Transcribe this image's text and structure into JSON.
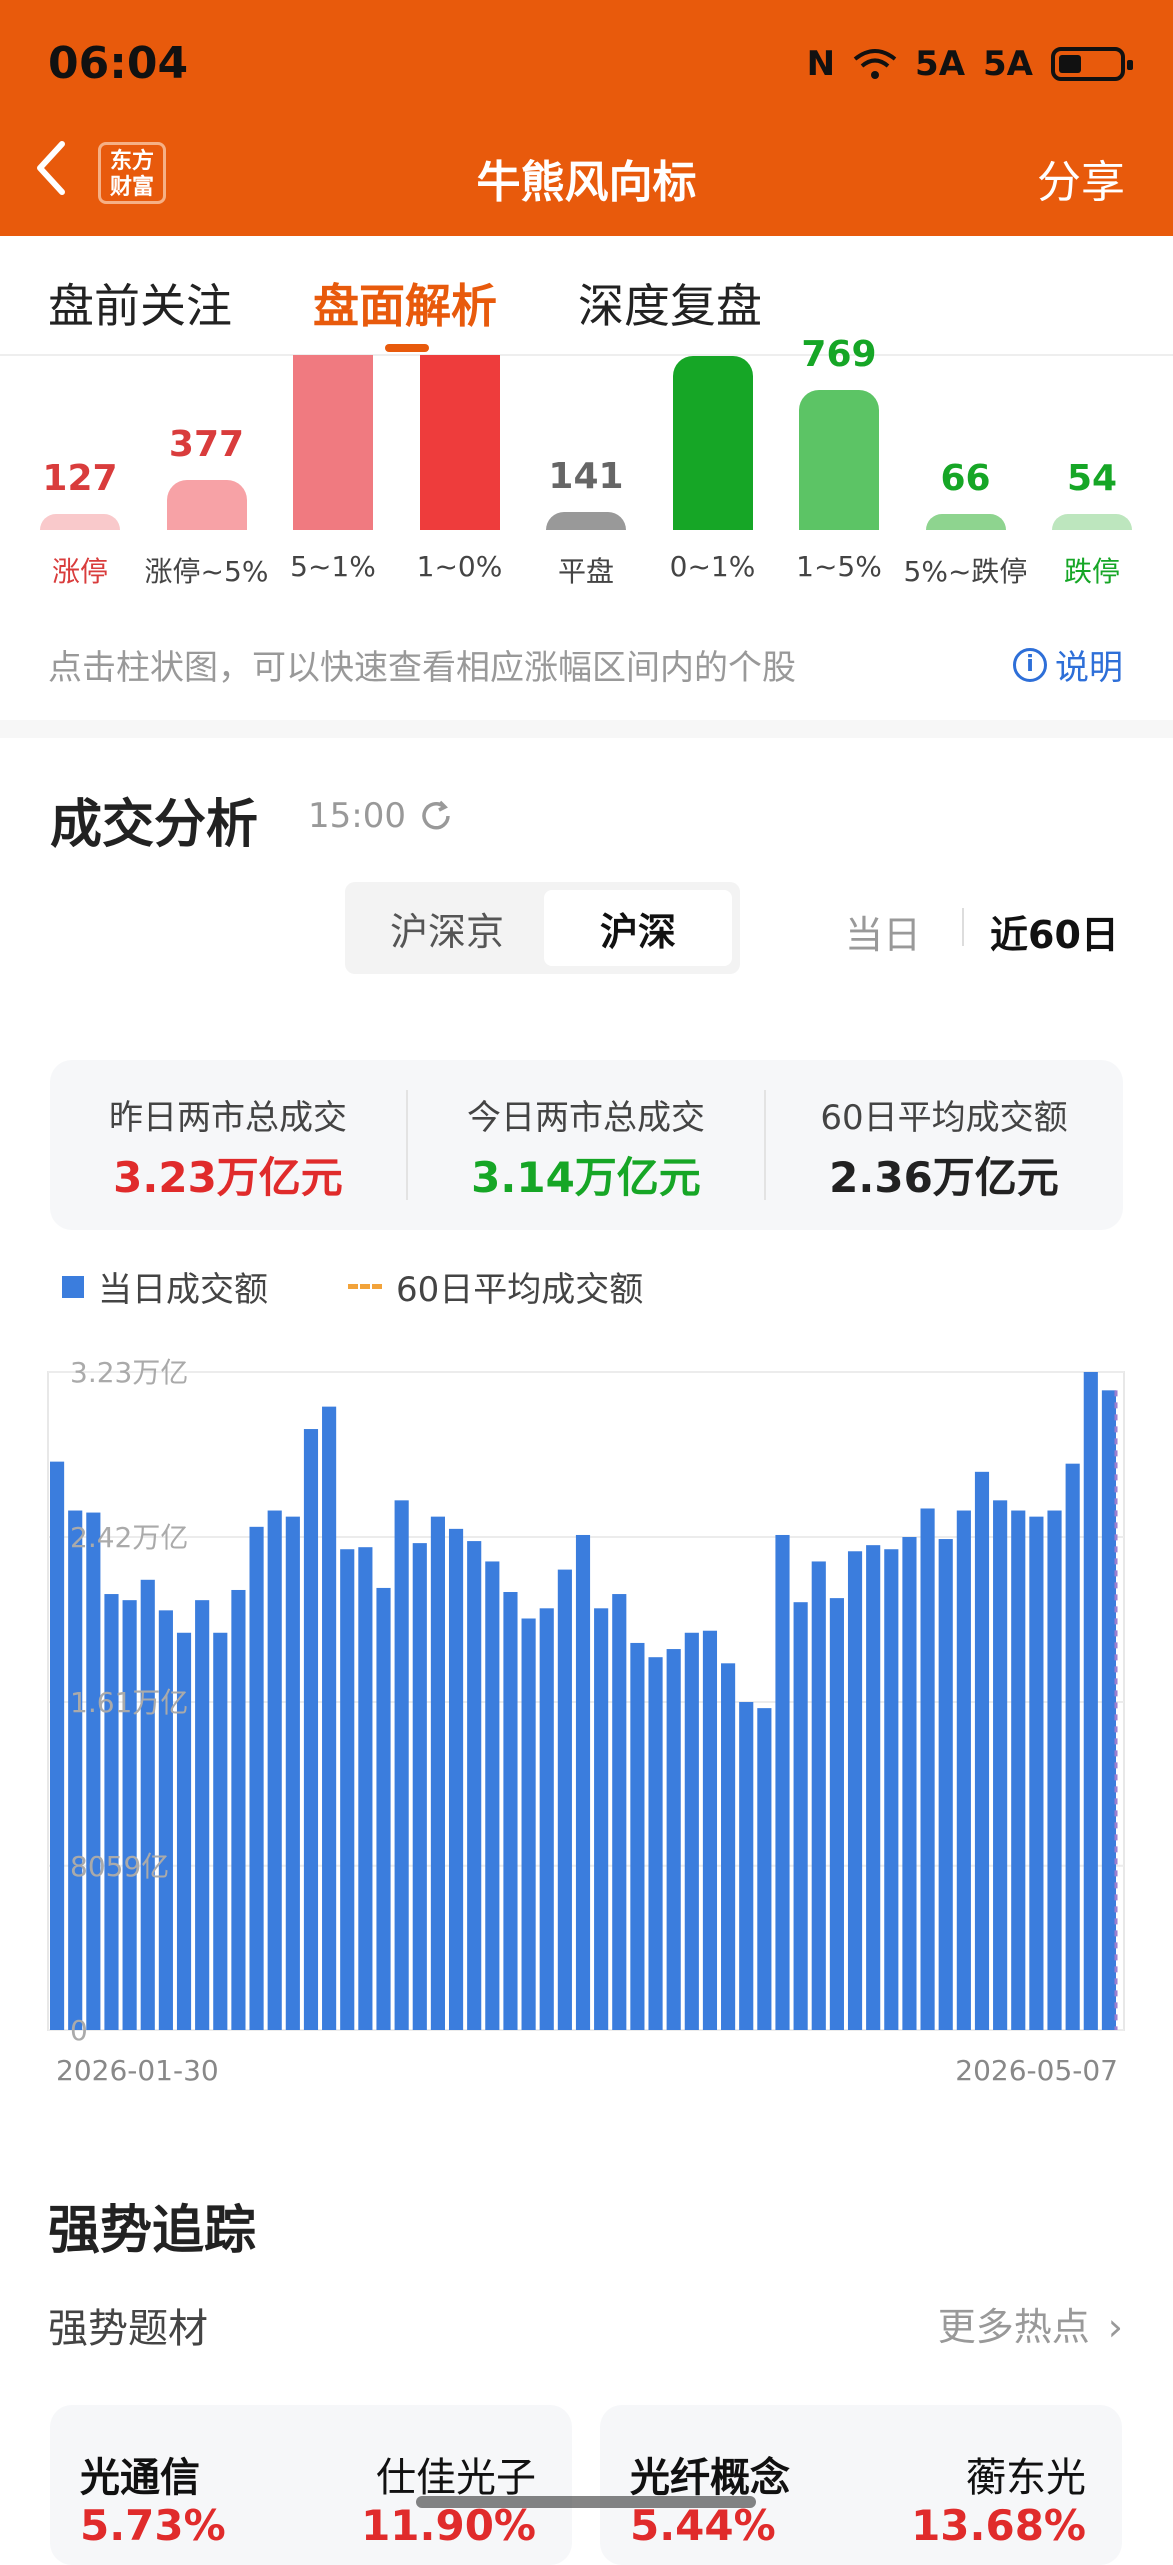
{
  "status_bar": {
    "time": "06:04",
    "signal1": "5A",
    "signal2": "5A"
  },
  "header": {
    "logo_text": "东方\n财富",
    "title": "牛熊风向标",
    "share": "分享"
  },
  "tabs": [
    {
      "label": "盘前关注",
      "active": false
    },
    {
      "label": "盘面解析",
      "active": true
    },
    {
      "label": "深度复盘",
      "active": false
    }
  ],
  "distribution": {
    "watermark": "东方财富",
    "bars": [
      {
        "category": "涨停",
        "count": "127",
        "color": "#F9C9CB",
        "label_color": "#D93C3C",
        "cat_color": "#D93C3C",
        "level": 0.08
      },
      {
        "category": "涨停~5%",
        "count": "377",
        "color": "#F7A2A6",
        "label_color": "#D93C3C",
        "cat_color": "#444444",
        "level": 0.25
      },
      {
        "category": "5~1%",
        "count": "",
        "color": "#F07A80",
        "label_color": "#D93C3C",
        "cat_color": "#444444",
        "level": 1.0
      },
      {
        "category": "1~0%",
        "count": "",
        "color": "#EE3C3C",
        "label_color": "#D93C3C",
        "cat_color": "#444444",
        "level": 0.98
      },
      {
        "category": "平盘",
        "count": "141",
        "color": "#999999",
        "label_color": "#666666",
        "cat_color": "#444444",
        "level": 0.09
      },
      {
        "category": "0~1%",
        "count": "",
        "color": "#16A626",
        "label_color": "#16A626",
        "cat_color": "#444444",
        "level": 0.87
      },
      {
        "category": "1~5%",
        "count": "769",
        "color": "#5CC465",
        "label_color": "#16A626",
        "cat_color": "#444444",
        "level": 0.7
      },
      {
        "category": "5%~跌停",
        "count": "66",
        "color": "#8ED48F",
        "label_color": "#16A626",
        "cat_color": "#444444",
        "level": 0.08
      },
      {
        "category": "跌停",
        "count": "54",
        "color": "#BDE6BE",
        "label_color": "#16A626",
        "cat_color": "#16A626",
        "level": 0.08
      }
    ],
    "hint": "点击柱状图，可以快速查看相应涨幅区间内的个股",
    "explain": "说明"
  },
  "volume": {
    "title": "成交分析",
    "time": "15:00",
    "markets": [
      {
        "label": "沪深京",
        "active": false
      },
      {
        "label": "沪深",
        "active": true
      }
    ],
    "range_today": "当日",
    "range_60": "近60日",
    "summary": [
      {
        "label": "昨日两市总成交",
        "value": "3.23万亿元",
        "color": "#E02B2B"
      },
      {
        "label": "今日两市总成交",
        "value": "3.14万亿元",
        "color": "#16A626"
      },
      {
        "label": "60日平均成交额",
        "value": "2.36万亿元",
        "color": "#222222"
      }
    ],
    "legend": {
      "daily": "当日成交额",
      "avg": "60日平均成交额"
    }
  },
  "chart_data": {
    "type": "bar",
    "title": "",
    "xlabel": "",
    "ylabel": "",
    "y_tick_labels": [
      "3.23万亿",
      "2.42万亿",
      "1.61万亿",
      "8059亿",
      "0"
    ],
    "ylim": [
      0,
      3.23
    ],
    "x_start_label": "2026-01-30",
    "x_end_label": "2026-05-07",
    "bar_color": "#3B7DDD",
    "avg_line_color": "#F2A33A",
    "series": [
      {
        "values": [
          2.79,
          2.55,
          2.54,
          2.14,
          2.11,
          2.21,
          2.06,
          1.95,
          2.11,
          1.95,
          2.16,
          2.47,
          2.55,
          2.52,
          2.95,
          3.06,
          2.36,
          2.37,
          2.17,
          2.6,
          2.39,
          2.52,
          2.46,
          2.4,
          2.3,
          2.15,
          2.02,
          2.07,
          2.26,
          2.43,
          2.07,
          2.14,
          1.9,
          1.83,
          1.87,
          1.95,
          1.96,
          1.8,
          1.61,
          1.58,
          2.43,
          2.1,
          2.3,
          2.12,
          2.35,
          2.38,
          2.36,
          2.42,
          2.56,
          2.41,
          2.55,
          2.74,
          2.6,
          2.55,
          2.52,
          2.55,
          2.78,
          3.23,
          3.14
        ]
      }
    ]
  },
  "strong": {
    "title": "强势追踪",
    "themes_title": "强势题材",
    "more": "更多热点",
    "cards": [
      {
        "name": "光通信",
        "pct": "5.73%",
        "stock": "仕佳光子",
        "stock_pct": "11.90%"
      },
      {
        "name": "光纤概念",
        "pct": "5.44%",
        "stock": "蘅东光",
        "stock_pct": "13.68%"
      }
    ]
  }
}
